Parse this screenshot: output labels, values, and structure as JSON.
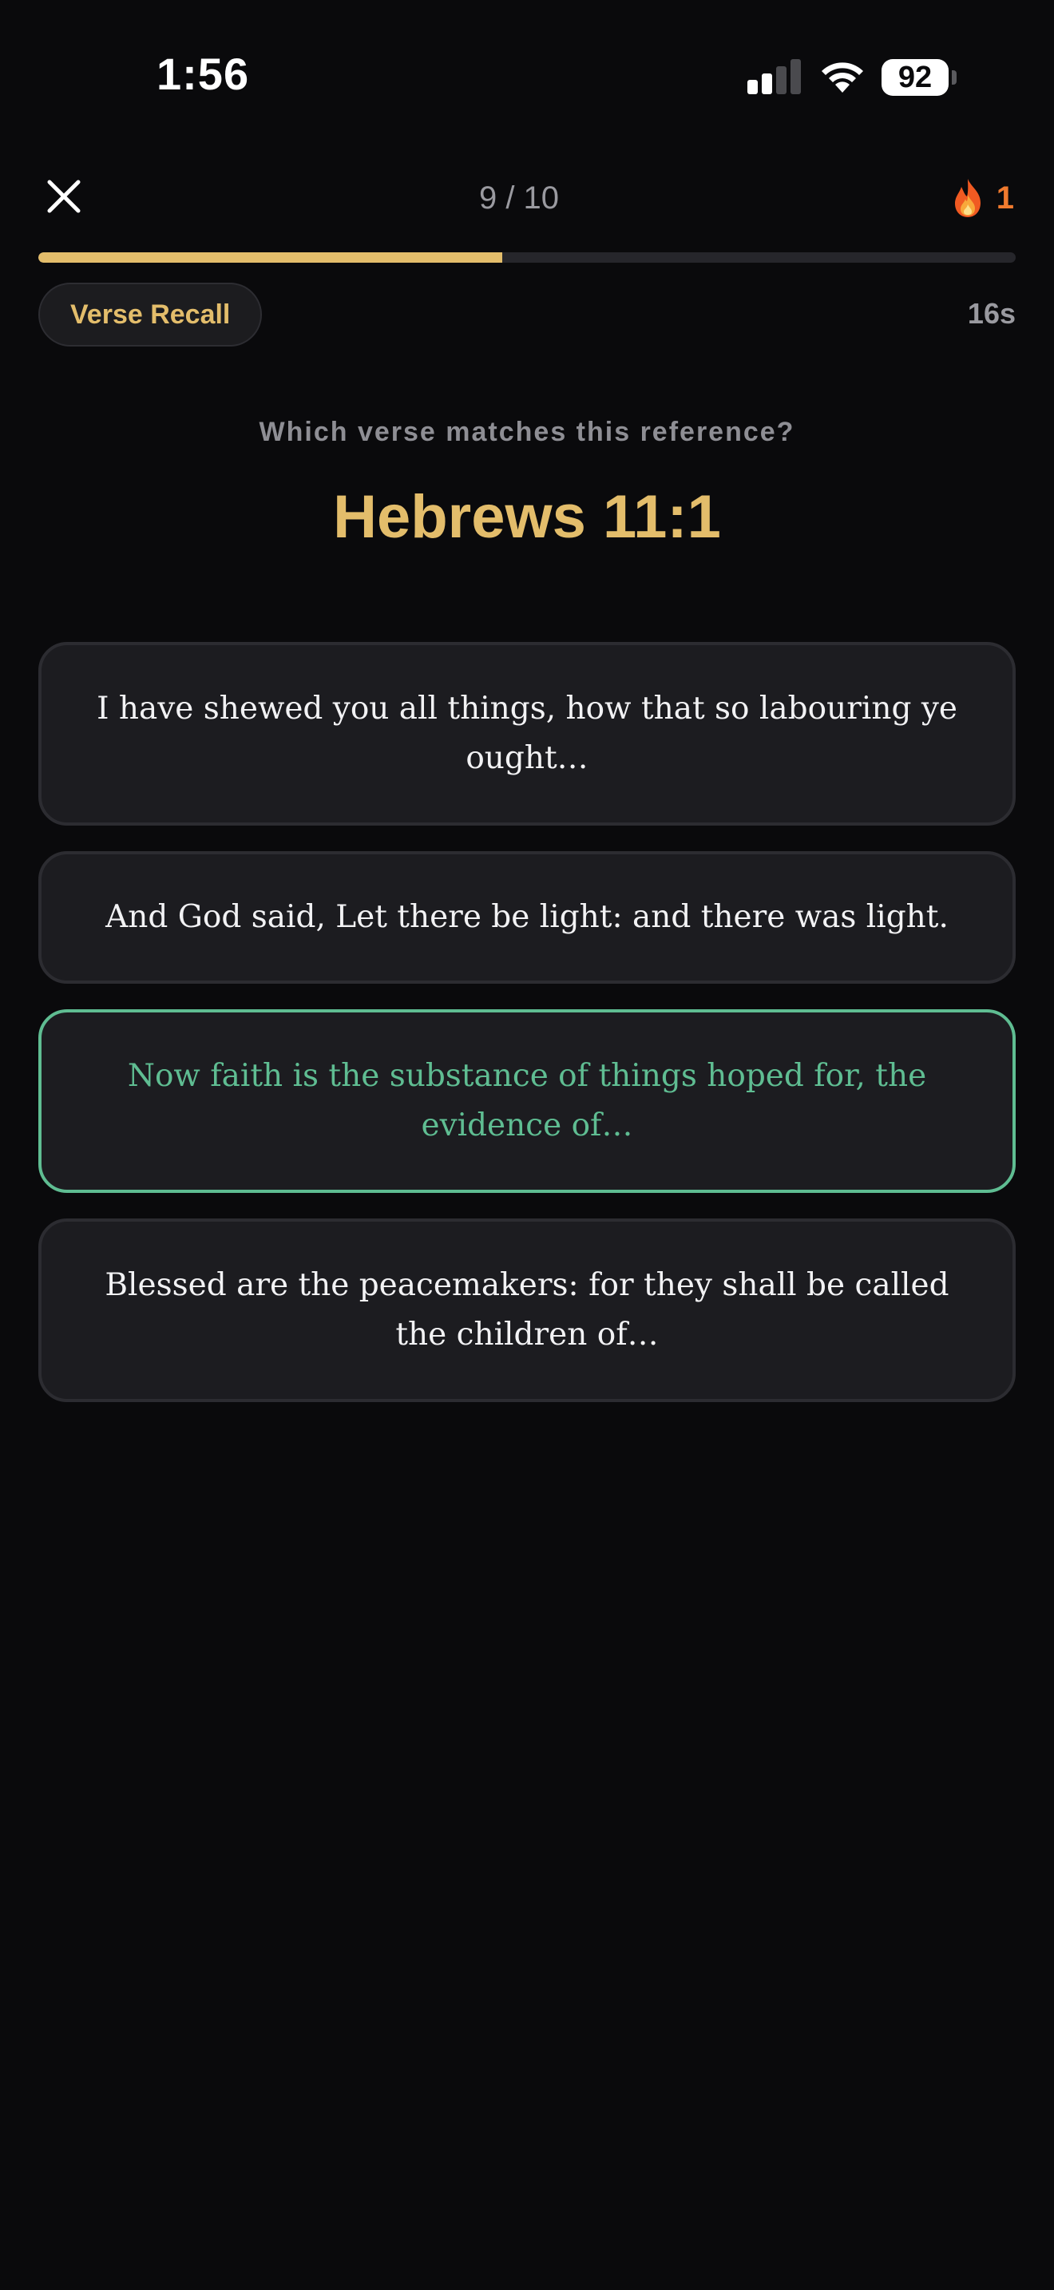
{
  "status_bar": {
    "time": "1:56",
    "battery": "92"
  },
  "header": {
    "progress_label": "9 / 10",
    "progress_fraction": 0.475,
    "streak_count": "1",
    "streak_icon": "fire-icon"
  },
  "mode": {
    "label": "Verse Recall",
    "timer": "16s"
  },
  "question": {
    "prompt": "Which verse matches this reference?",
    "reference": "Hebrews 11:1"
  },
  "options": [
    {
      "text": "I have shewed you all things, how that so labouring ye ought…",
      "state": "default"
    },
    {
      "text": "And God said, Let there be light: and there was light.",
      "state": "default"
    },
    {
      "text": "Now faith is the substance of things hoped for, the evidence of…",
      "state": "correct"
    },
    {
      "text": "Blessed are the peacemakers: for they shall be called the children of…",
      "state": "default"
    }
  ],
  "colors": {
    "background": "#0a0a0c",
    "accent_gold": "#e3bd6b",
    "correct_green": "#5fbd92",
    "streak_orange": "#f07a2e"
  }
}
